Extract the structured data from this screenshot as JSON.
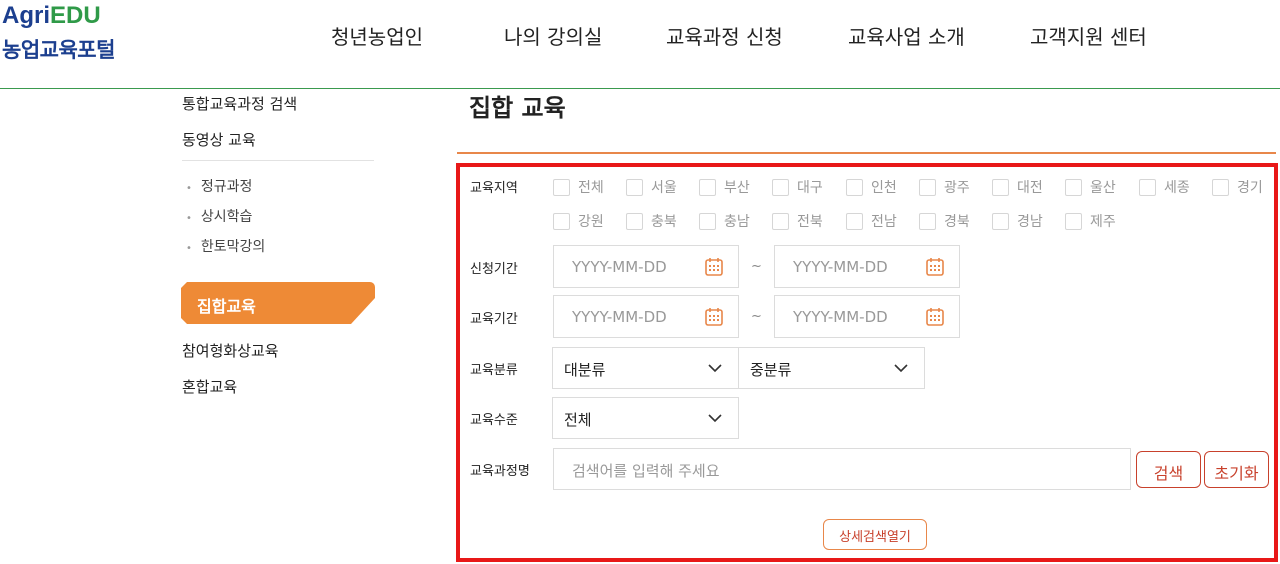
{
  "logo": {
    "top_a": "Agri",
    "top_b": "EDU",
    "bottom": "농업교육포털"
  },
  "gnb": [
    "청년농업인",
    "나의 강의실",
    "교육과정 신청",
    "교육사업 소개",
    "고객지원 센터"
  ],
  "sidebar": {
    "items_top": [
      "통합교육과정 검색",
      "동영상 교육"
    ],
    "sub_items": [
      "정규과정",
      "상시학습",
      "한토막강의"
    ],
    "active": "집합교육",
    "items_bottom": [
      "참여형화상교육",
      "혼합교육"
    ]
  },
  "page": {
    "title": "집합 교육"
  },
  "form": {
    "region_label": "교육지역",
    "regions_row1": [
      "전체",
      "서울",
      "부산",
      "대구",
      "인천",
      "광주",
      "대전",
      "울산",
      "세종",
      "경기"
    ],
    "regions_row2": [
      "강원",
      "충북",
      "충남",
      "전북",
      "전남",
      "경북",
      "경남",
      "제주"
    ],
    "apply_label": "신청기간",
    "edu_period_label": "교육기간",
    "date_placeholder": "YYYY-MM-DD",
    "tilde": "~",
    "category_label": "교육분류",
    "major_category": "대분류",
    "minor_category": "중분류",
    "level_label": "교육수준",
    "level_value": "전체",
    "course_name_label": "교육과정명",
    "search_placeholder": "검색어를 입력해 주세요",
    "search_button": "검색",
    "reset_button": "초기화",
    "advanced_button": "상세검색열기"
  },
  "colors": {
    "accent_orange": "#ee8a36",
    "brand_blue": "#1c3f8f",
    "brand_green": "#2f9a48",
    "highlight_red": "#e81818",
    "button_red": "#c8412c"
  },
  "icons": {
    "calendar": "calendar-icon",
    "chevron": "chevron-down-icon"
  }
}
